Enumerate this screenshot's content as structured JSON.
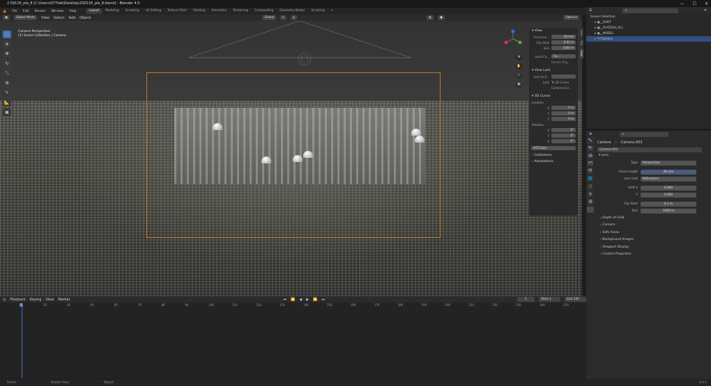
{
  "window": {
    "title": "2.59116_pla_8 [C:\\Users\\077fab\\Desktop\\230116_pla_8.blend] - Blender 4.0",
    "controls": [
      "—",
      "☐",
      "✕"
    ]
  },
  "menu": {
    "items": [
      "File",
      "Edit",
      "Render",
      "Window",
      "Help"
    ]
  },
  "workspaces": [
    "Layout",
    "Modeling",
    "Sculpting",
    "UV Editing",
    "Texture Paint",
    "Shading",
    "Animation",
    "Rendering",
    "Compositing",
    "Geometry Nodes",
    "Scripting"
  ],
  "scene": {
    "name": "Scene",
    "view_layer": "ViewLayer"
  },
  "header3d": {
    "mode": "Object Mode",
    "view": "View",
    "select": "Select",
    "add": "Add",
    "object": "Object",
    "orientation": "Global",
    "options": "Options"
  },
  "viewport": {
    "line1": "Camera Perspective",
    "line2": "(1) Scene Collection | Camera"
  },
  "tools": [
    "select-tool",
    "cursor-tool",
    "move-tool",
    "rotate-tool",
    "scale-tool",
    "transform-tool",
    "annotate-tool",
    "measure-tool",
    "add-cube-tool"
  ],
  "npanel": {
    "view_header": "View",
    "focal_label": "Focal Len...",
    "focal_value": "50 mm",
    "clip_start_label": "Clip Start",
    "clip_start_value": "0.01 m",
    "clip_end_label": "End",
    "clip_end_value": "1000 m",
    "local_cam_label": "Local Ca...",
    "render_reg": "Render Reg...",
    "view_lock_header": "View Lock",
    "lock_to_obj": "Lock to O...",
    "lock_label": "Lock",
    "to3d": "To 3D Cursor",
    "camera_to_view": "Camera to V...",
    "cursor_header": "3D Cursor",
    "location": "Location",
    "rotation": "Rotation",
    "x": "X",
    "y": "Y",
    "z": "Z",
    "loc_vals": [
      "0 m",
      "0 m",
      "0 m"
    ],
    "rot_vals": [
      "0°",
      "0°",
      "0°"
    ],
    "euler": "XYZ Euler",
    "collections": "Collections",
    "annotations": "Annotations",
    "tabs": [
      "Item",
      "Tool",
      "View"
    ]
  },
  "timeline": {
    "playback": "Playback",
    "keying": "Keying",
    "view": "View",
    "marker": "Marker",
    "current_frame": "1",
    "start_label": "Start",
    "start": "1",
    "end_label": "End",
    "end": "250",
    "ticks": [
      "1",
      "10",
      "20",
      "40",
      "60",
      "70",
      "80",
      "90",
      "100",
      "110",
      "120",
      "130",
      "140",
      "150",
      "160",
      "170",
      "180",
      "190",
      "200",
      "210",
      "220",
      "230",
      "240",
      "250"
    ]
  },
  "status": {
    "select": "Select",
    "rotate": "Rotate View",
    "object": "Object",
    "version": "4.0.1"
  },
  "outliner": {
    "root": "Scene Collection",
    "items": [
      {
        "name": "__SHOT"
      },
      {
        "name": "__PLATEAU_ALL"
      },
      {
        "name": "__MODEL"
      },
      {
        "name": "Camera"
      }
    ]
  },
  "properties": {
    "breadcrumb_a": "Camera",
    "breadcrumb_b": "Camera.003",
    "datablock": "Camera.003",
    "lens_header": "Lens",
    "type_label": "Type",
    "type_value": "Perspective",
    "focal_label": "Focal Length",
    "focal_value": "48 mm",
    "lens_unit_label": "Lens Unit",
    "lens_unit_value": "Millimeters",
    "shift_x_label": "Shift X",
    "shift_x_value": "0.000",
    "shift_y_label": "Y",
    "shift_y_value": "0.000",
    "clip_start_label": "Clip Start",
    "clip_start_value": "0.1 m",
    "clip_end_label": "End",
    "clip_end_value": "1000 m",
    "subpanels": [
      "Depth of Field",
      "Camera",
      "Safe Areas",
      "Background Images",
      "Viewport Display",
      "Custom Properties"
    ]
  }
}
